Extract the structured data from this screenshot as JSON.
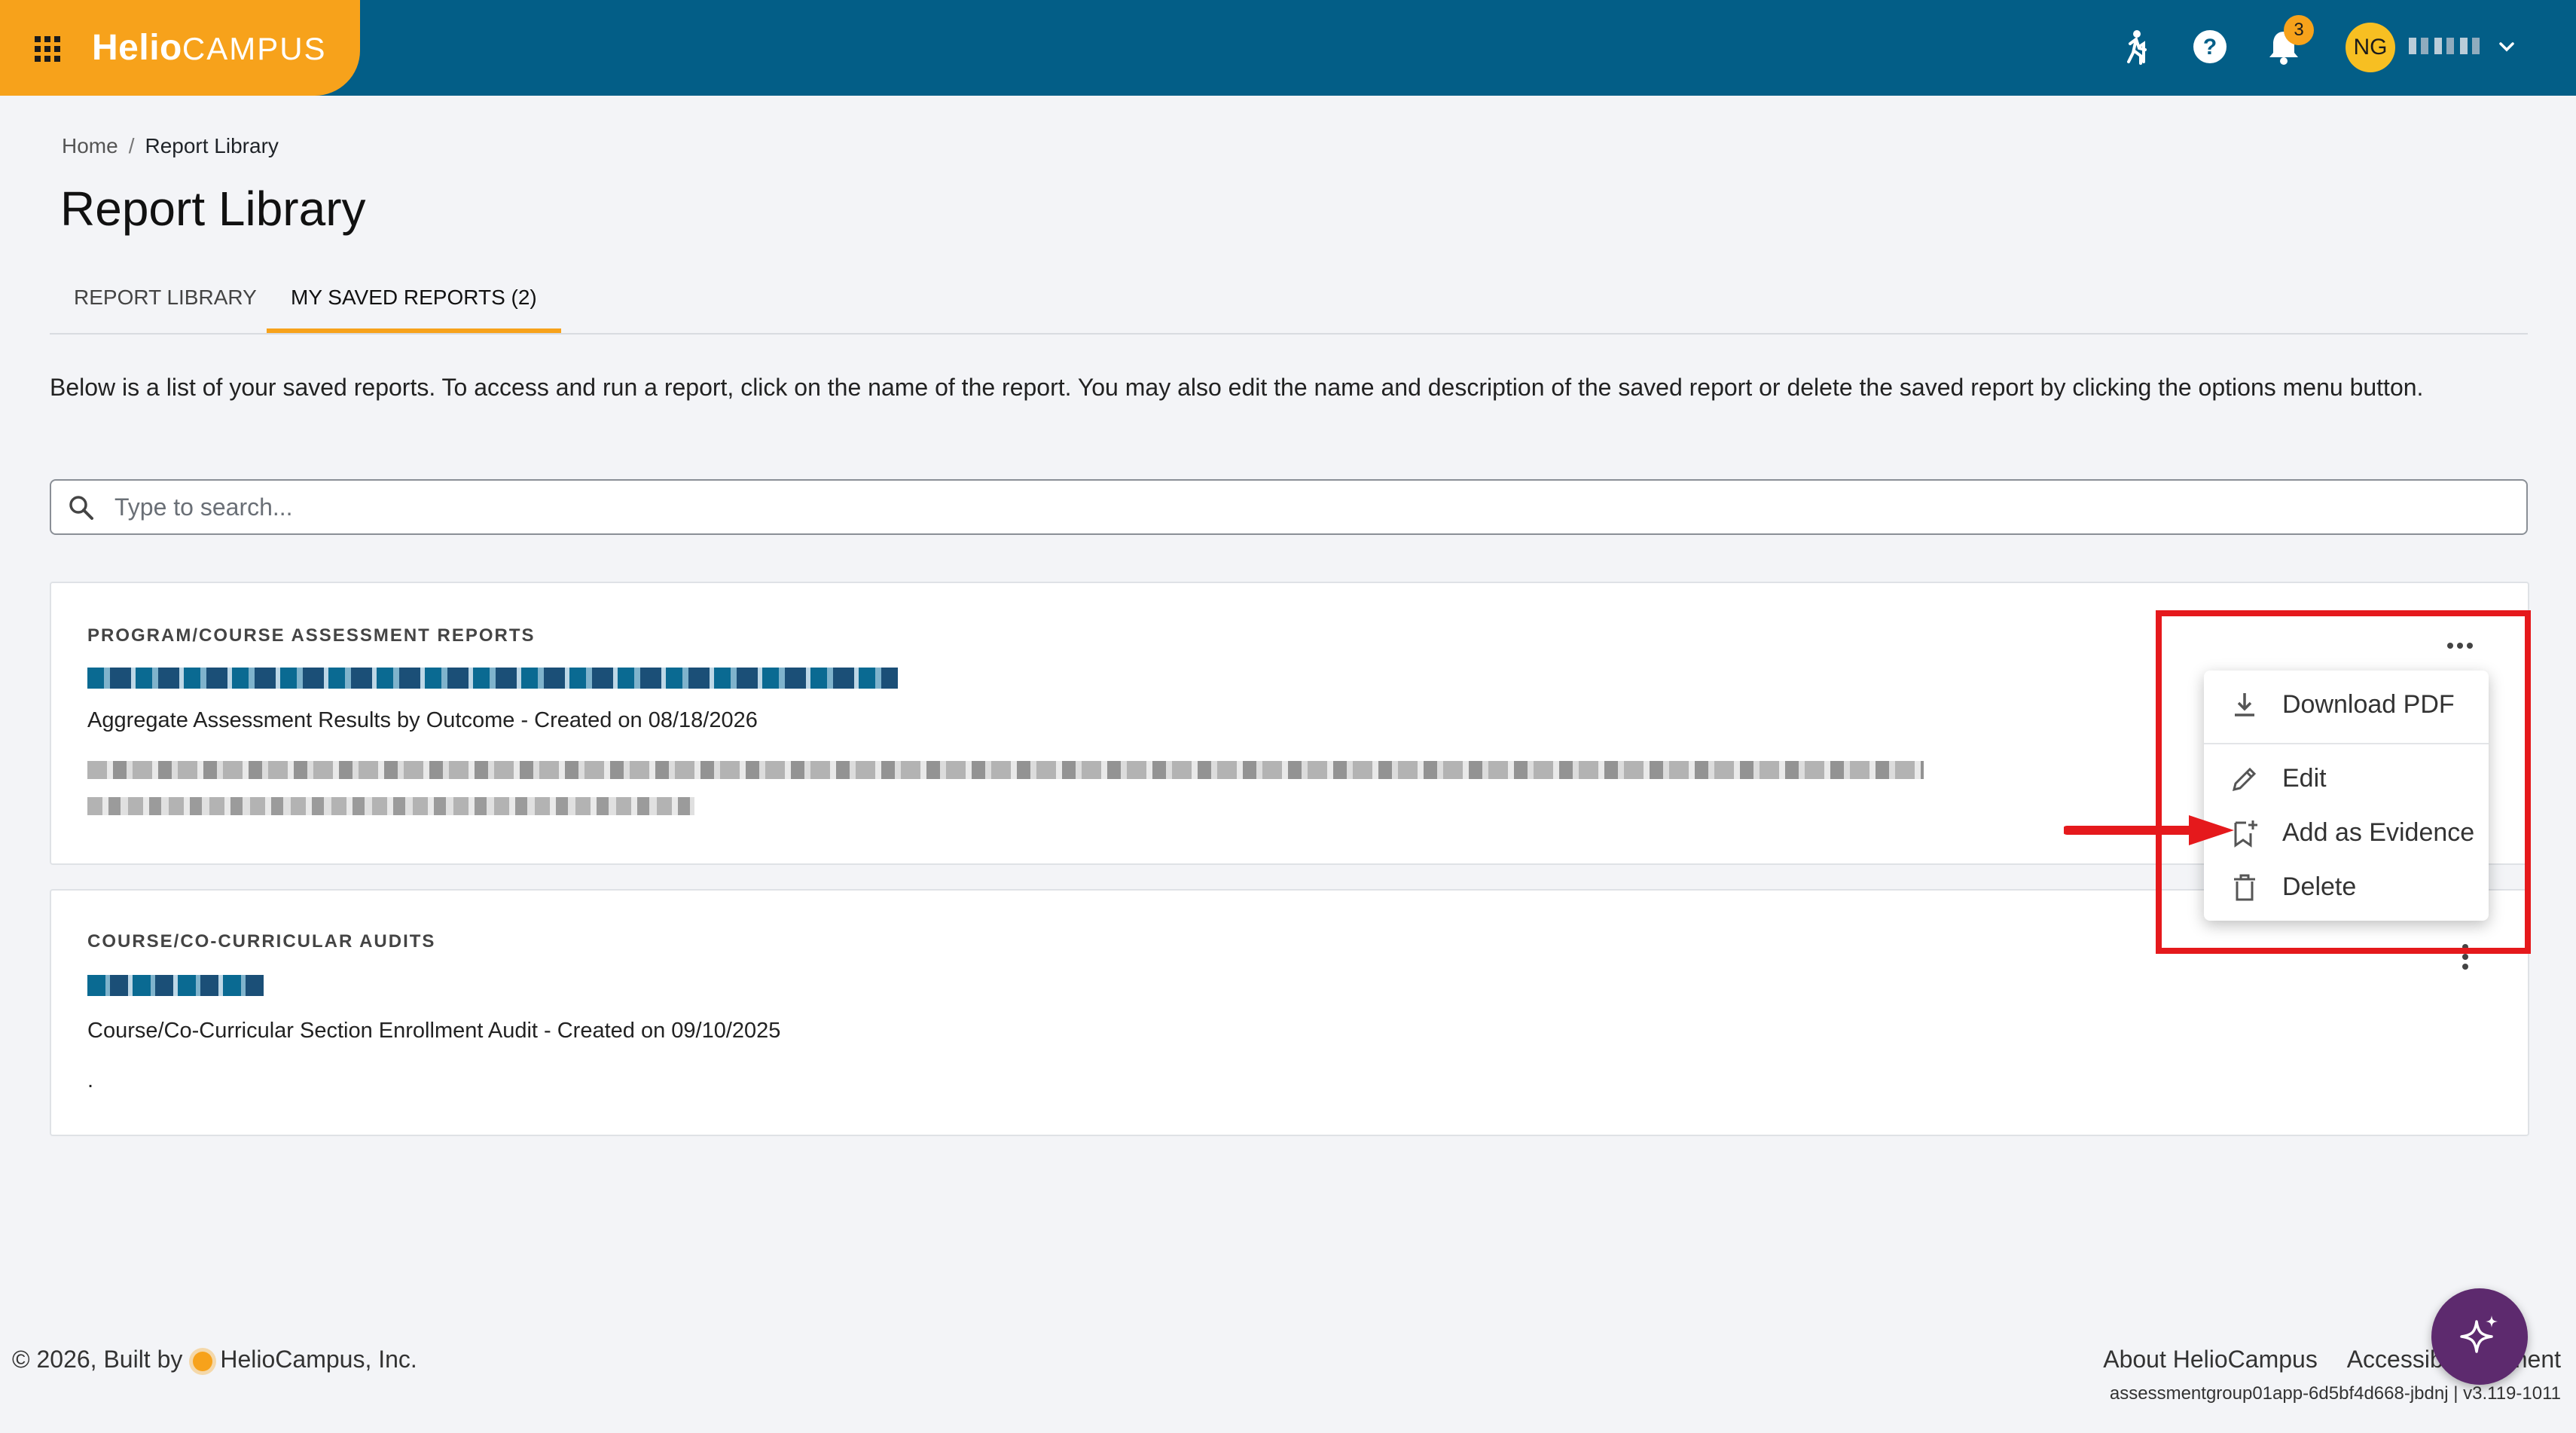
{
  "header": {
    "brand_bold": "Helio",
    "brand_light": "CAMPUS",
    "notification_count": "3",
    "avatar_initials": "NG",
    "icons": [
      "apps-grid-icon",
      "walkthrough-icon",
      "help-icon",
      "bell-icon",
      "chevron-down-icon"
    ]
  },
  "breadcrumb": {
    "home": "Home",
    "separator": "/",
    "current": "Report Library"
  },
  "page_title": "Report Library",
  "tabs": [
    {
      "label": "REPORT LIBRARY",
      "active": false
    },
    {
      "label": "MY SAVED REPORTS (2)",
      "active": true
    }
  ],
  "description": "Below is a list of your saved reports. To access and run a report, click on the name of the report. You may also edit the name and description of the saved report or delete the saved report by clicking the options menu button.",
  "search": {
    "placeholder": "Type to search...",
    "value": ""
  },
  "reports": [
    {
      "category": "PROGRAM/COURSE ASSESSMENT REPORTS",
      "meta": "Aggregate Assessment Results by Outcome - Created on 08/18/2026"
    },
    {
      "category": "COURSE/CO-CURRICULAR AUDITS",
      "meta": "Course/Co-Curricular Section Enrollment Audit - Created on 09/10/2025",
      "description": "."
    }
  ],
  "options_menu": {
    "items": [
      {
        "label": "Download PDF",
        "icon": "download-icon"
      },
      {
        "label": "Edit",
        "icon": "pencil-icon"
      },
      {
        "label": "Add as Evidence",
        "icon": "bookmark-add-icon"
      },
      {
        "label": "Delete",
        "icon": "trash-icon"
      }
    ]
  },
  "footer": {
    "copyright_prefix": "© 2026, Built by",
    "company": "HelioCampus, Inc.",
    "links": [
      "About HelioCampus",
      "Accessibility",
      "ment"
    ],
    "build": "assessmentgroup01app-6d5bf4d668-jbdnj | v3.119-1011"
  },
  "colors": {
    "header": "#035e87",
    "brand": "#f7a21b",
    "highlight": "#e5191c",
    "fab": "#5d2a6e"
  }
}
